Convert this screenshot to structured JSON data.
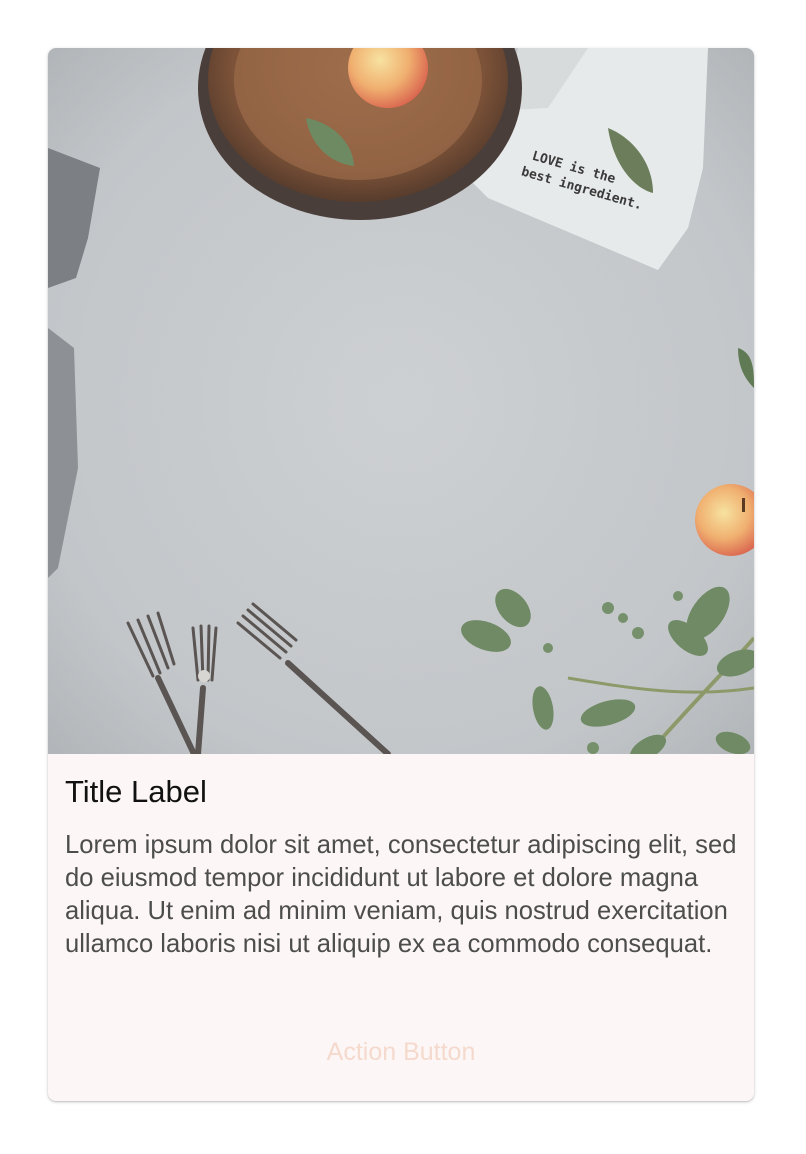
{
  "card": {
    "image": {
      "description": "",
      "napkin_text": [
        "LOVE is the",
        "best ingredient."
      ]
    },
    "title": "Title Label",
    "body": "Lorem ipsum dolor sit amet, consectetur adipiscing elit, sed do eiusmod tempor incididunt ut labore et dolore magna aliqua. Ut enim ad minim veniam, quis nostrud exercitation ullamco laboris nisi ut aliquip ex ea commodo consequat.",
    "action_label": "Action Button"
  },
  "colors": {
    "card_background": "#fcf7f6",
    "title_text": "#111111",
    "body_text": "#4d4d4d",
    "action_text": "#f5d9cd"
  }
}
